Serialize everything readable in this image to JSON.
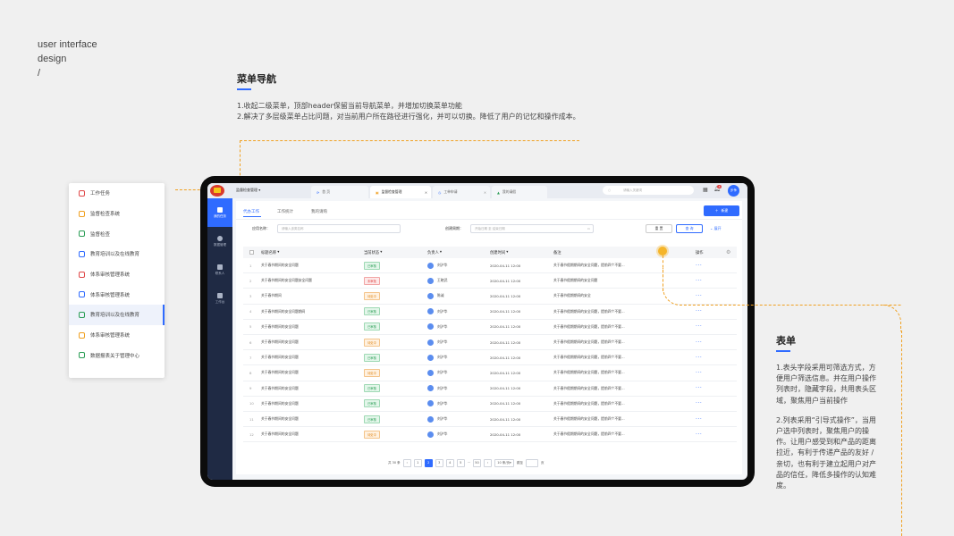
{
  "tagline": {
    "line1": "user interface",
    "line2": "design",
    "line3": "/"
  },
  "section_menu": {
    "title": "菜单导航",
    "desc1": "1.收起二级菜单，顶部header保留当前导航菜单，并增加切换菜单功能",
    "desc2": "2.解决了多层级菜单占比问题，对当前用户所在路径进行强化，并可以切换。降低了用户的记忆和操作成本。"
  },
  "section_table": {
    "title": "表单",
    "desc1": "1.表头字段采用可筛选方式，方便用户筛选信息。并在用户操作列表时，隐藏字段，共用表头区域，聚焦用户当前操作",
    "desc2": "2.列表采用“引导式操作”，当用户选中列表时，聚焦用户的操作。让用户感受到和产品的距离拉近，有利于传递产品的友好 / 亲切，也有利于建立起用户对产品的信任，降低多操作的认知难度。"
  },
  "menu_items": [
    {
      "label": "工作任务",
      "icon": "target-icon",
      "color": "#e04848"
    },
    {
      "label": "监督检查系统",
      "icon": "monitor-icon",
      "color": "#f0a020"
    },
    {
      "label": "监督检查",
      "icon": "chart-icon",
      "color": "#2a9d55"
    },
    {
      "label": "教育培训以及在线教育",
      "icon": "education-icon",
      "color": "#2f6bff"
    },
    {
      "label": "体系审核管理系统",
      "icon": "audit-icon",
      "color": "#e04848"
    },
    {
      "label": "体系审核管理系统",
      "icon": "folder-icon",
      "color": "#2f6bff"
    },
    {
      "label": "教育培训以及在线教育",
      "icon": "grid-icon",
      "color": "#2a9d55"
    },
    {
      "label": "体系审核管理系统",
      "icon": "shield-icon",
      "color": "#f0a020"
    },
    {
      "label": "数据报表关于管理中心",
      "icon": "report-icon",
      "color": "#2a9d55"
    }
  ],
  "app": {
    "system_title": "监督检查管理",
    "tabs": [
      {
        "label": "首 页"
      },
      {
        "label": "监督检查管理"
      },
      {
        "label": "工单申请"
      },
      {
        "label": "我的请假"
      }
    ],
    "search_placeholder": "请输入关键词",
    "notification_count": "3",
    "user": "步争",
    "leftnav": [
      {
        "label": "我的任务"
      },
      {
        "label": "数据管理"
      },
      {
        "label": "联系人"
      },
      {
        "label": "工作台"
      }
    ],
    "subtabs": [
      "代办工作",
      "工作统计",
      "我的请购"
    ],
    "new_button": "新建",
    "filter": {
      "apply_label": "应用名称：",
      "apply_placeholder": "请输入该类名称",
      "date_label": "创建周期：",
      "date_placeholder": "开始日期 至 结束日期",
      "reset": "重 置",
      "query": "查 询",
      "expand": "展开"
    },
    "columns": [
      "标题名称",
      "当前状态",
      "负责人",
      "创建时间",
      "备注",
      "操作"
    ],
    "rows": [
      {
        "no": "1",
        "title": "关于春节期间的安全问题",
        "status": "已审核",
        "status_type": "green",
        "owner": "刘沪华",
        "time": "2020-04-11 12:00",
        "note": "关于春节假期期间的安全问题，提前四个不要…"
      },
      {
        "no": "2",
        "title": "关于春节期间的安全问题安全问题",
        "status": "未审批",
        "status_type": "red",
        "owner": "王晓武",
        "time": "2020-04-11 12:00",
        "note": "关于春节假期期间的安全问题"
      },
      {
        "no": "3",
        "title": "关于春节期间",
        "status": "待处中",
        "status_type": "orange",
        "owner": "陈诚",
        "time": "2020-04-11 12:00",
        "note": "关于春节假期期间的安全"
      },
      {
        "no": "4",
        "title": "关于春节期间的安全问题期间",
        "status": "已审核",
        "status_type": "green",
        "owner": "刘沪华",
        "time": "2020-04-11 12:00",
        "note": "关于春节假期期间的安全问题，提前四个不要…"
      },
      {
        "no": "5",
        "title": "关于春节期间的安全问题",
        "status": "已审核",
        "status_type": "green",
        "owner": "刘沪华",
        "time": "2020-04-11 12:00",
        "note": "关于春节假期期间的安全问题，提前四个不要…"
      },
      {
        "no": "6",
        "title": "关于春节期间的安全问题",
        "status": "待处中",
        "status_type": "orange",
        "owner": "刘沪华",
        "time": "2020-04-11 12:00",
        "note": "关于春节假期期间的安全问题，提前四个不要…"
      },
      {
        "no": "7",
        "title": "关于春节期间的安全问题",
        "status": "已审核",
        "status_type": "green",
        "owner": "刘沪华",
        "time": "2020-04-11 12:00",
        "note": "关于春节假期期间的安全问题，提前四个不要…"
      },
      {
        "no": "8",
        "title": "关于春节期间的安全问题",
        "status": "待处中",
        "status_type": "orange",
        "owner": "刘沪华",
        "time": "2020-04-11 12:00",
        "note": "关于春节假期期间的安全问题，提前四个不要…"
      },
      {
        "no": "9",
        "title": "关于春节期间的安全问题",
        "status": "已审核",
        "status_type": "green",
        "owner": "刘沪华",
        "time": "2020-04-11 12:00",
        "note": "关于春节假期期间的安全问题，提前四个不要…"
      },
      {
        "no": "10",
        "title": "关于春节期间的安全问题",
        "status": "已审核",
        "status_type": "green",
        "owner": "刘沪华",
        "time": "2020-04-11 12:00",
        "note": "关于春节假期期间的安全问题，提前四个不要…"
      },
      {
        "no": "11",
        "title": "关于春节期间的安全问题",
        "status": "已审核",
        "status_type": "green",
        "owner": "刘沪华",
        "time": "2020-04-11 12:00",
        "note": "关于春节假期期间的安全问题，提前四个不要…"
      },
      {
        "no": "12",
        "title": "关于春节期间的安全问题",
        "status": "待处中",
        "status_type": "orange",
        "owner": "刘沪华",
        "time": "2020-04-11 12:00",
        "note": "关于春节假期期间的安全问题，提前四个不要…"
      }
    ],
    "pagination": {
      "total": "共 30 条",
      "pages": [
        "1",
        "2",
        "3",
        "4",
        "5"
      ],
      "current": "2",
      "ellipsis": "···",
      "last": "50",
      "per_page": "10 条/页",
      "jump": "跳至",
      "page_suffix": "页"
    },
    "colors": {
      "accent": "#2f6bff",
      "nav_bg": "#1f2a44",
      "guide": "#f0a020"
    }
  }
}
